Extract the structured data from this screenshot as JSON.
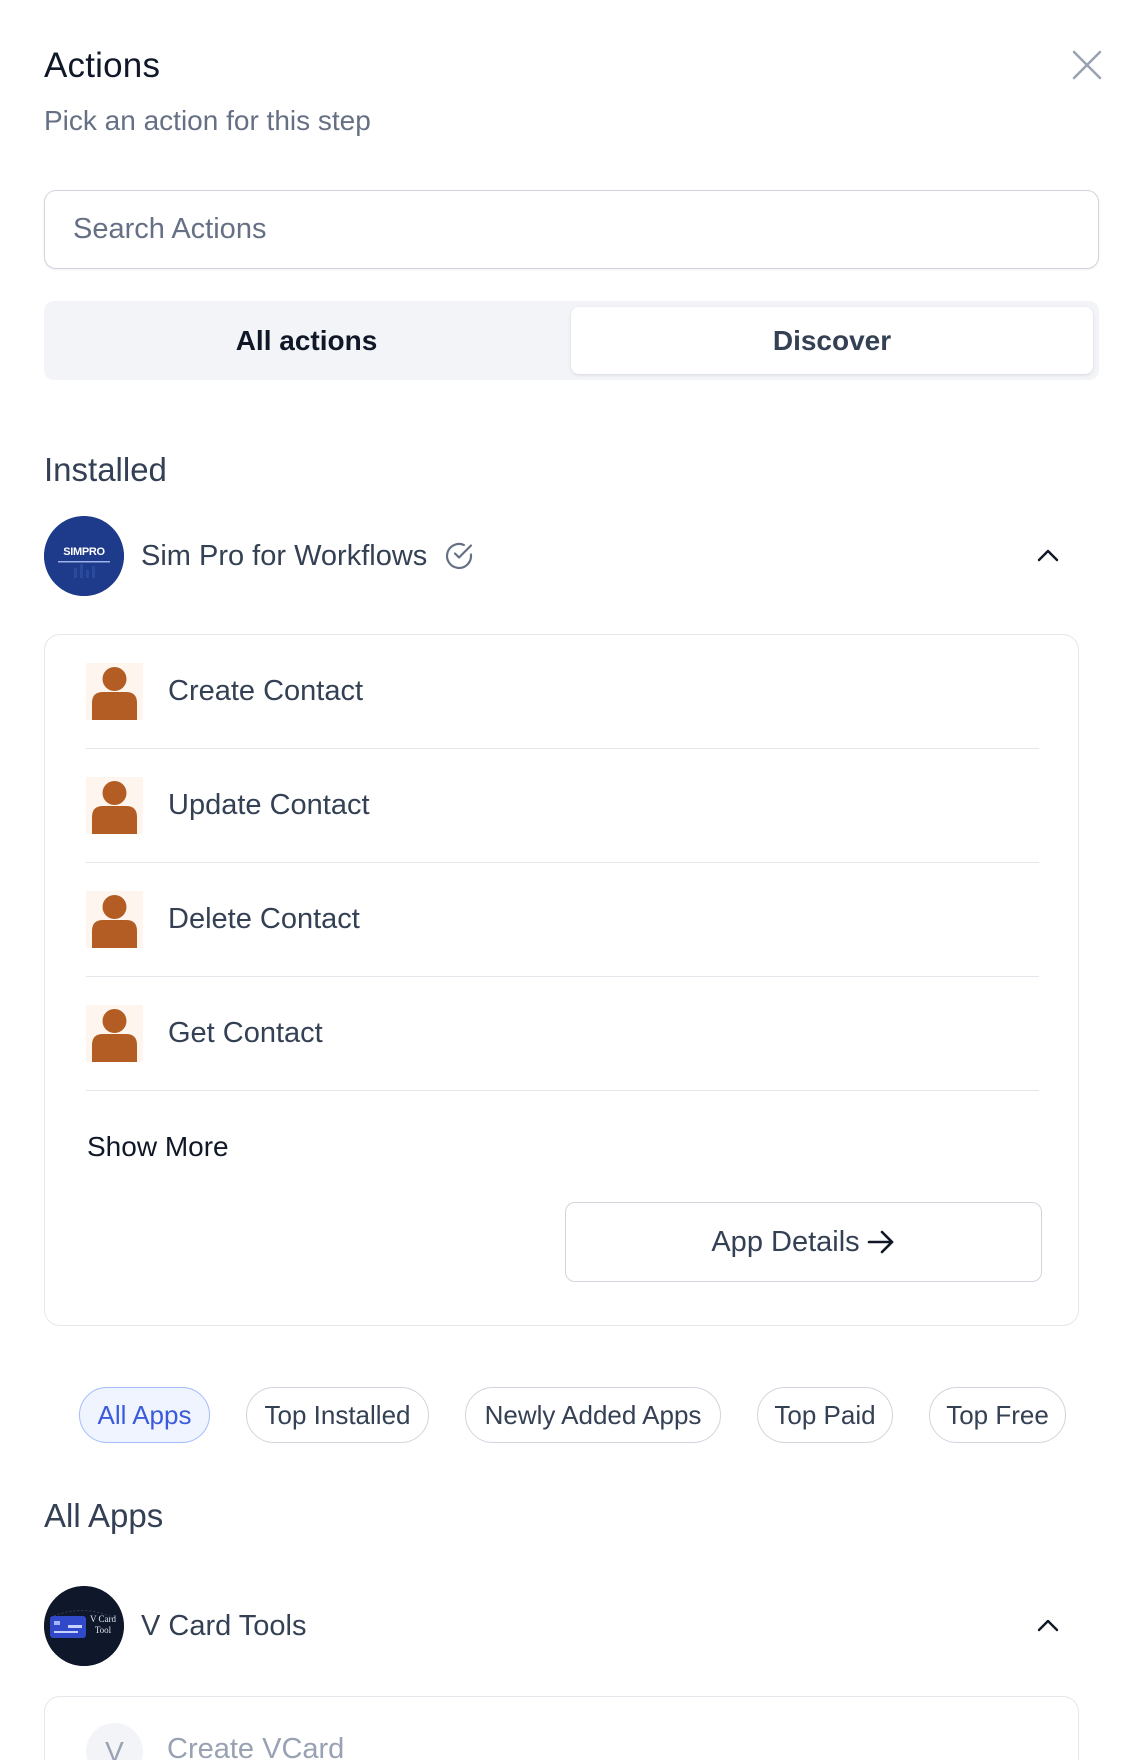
{
  "header": {
    "title": "Actions",
    "subtitle": "Pick an action for this step"
  },
  "search": {
    "placeholder": "Search Actions",
    "value": ""
  },
  "tabs": [
    {
      "label": "All actions",
      "selected": false
    },
    {
      "label": "Discover",
      "selected": true
    }
  ],
  "installed": {
    "section_title": "Installed",
    "app": {
      "name": "Sim Pro for Workflows",
      "logo_text": "SIMPRO",
      "verified": true,
      "expanded": true
    },
    "actions": [
      {
        "label": "Create Contact",
        "icon": "person-icon"
      },
      {
        "label": "Update Contact",
        "icon": "person-icon"
      },
      {
        "label": "Delete Contact",
        "icon": "person-icon"
      },
      {
        "label": "Get Contact",
        "icon": "person-icon"
      }
    ],
    "show_more_label": "Show More",
    "app_details_label": "App Details"
  },
  "filters": [
    {
      "label": "All Apps",
      "active": true
    },
    {
      "label": "Top Installed",
      "active": false
    },
    {
      "label": "Newly Added Apps",
      "active": false
    },
    {
      "label": "Top Paid",
      "active": false
    },
    {
      "label": "Top Free",
      "active": false
    }
  ],
  "all_apps": {
    "section_title": "All Apps",
    "app": {
      "name": "V Card Tools",
      "logo_text": "V Card Tool",
      "expanded": true
    },
    "actions": [
      {
        "label": "Create VCard",
        "avatar_letter": "V"
      }
    ]
  },
  "colors": {
    "accent": "#3b5bdb",
    "accent_bg": "#eff4ff",
    "person_icon": "#b35d24",
    "simpro_logo_bg": "#1e3a8a",
    "vcard_logo_bg": "#0f172a"
  }
}
